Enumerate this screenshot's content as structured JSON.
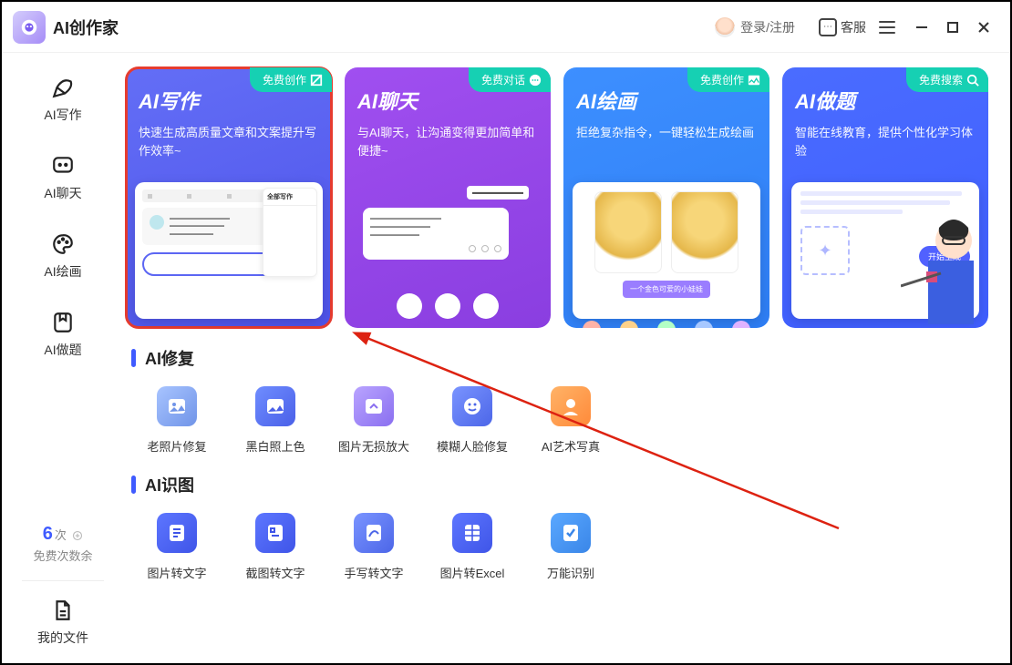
{
  "header": {
    "title": "AI创作家",
    "login": "登录/注册",
    "support": "客服"
  },
  "sidebar": {
    "items": [
      {
        "label": "AI写作"
      },
      {
        "label": "AI聊天"
      },
      {
        "label": "AI绘画"
      },
      {
        "label": "AI做题"
      }
    ],
    "free_count": "6",
    "free_unit": "次",
    "free_label": "免费次数余",
    "files_label": "我的文件"
  },
  "cards": [
    {
      "title": "AI写作",
      "badge": "免费创作",
      "desc": "快速生成高质量文章和文案提升写作效率~",
      "side_header": "全部写作"
    },
    {
      "title": "AI聊天",
      "badge": "免费对话",
      "desc": "与AI聊天，让沟通变得更加简单和便捷~"
    },
    {
      "title": "AI绘画",
      "badge": "免费创作",
      "desc": "拒绝复杂指令，一键轻松生成绘画",
      "tag": "一个金色可爱的小娃娃"
    },
    {
      "title": "AI做题",
      "badge": "免费搜索",
      "desc": "智能在线教育，提供个性化学习体验",
      "btn": "开始生成"
    }
  ],
  "sections": {
    "repair": {
      "title": "AI修复",
      "items": [
        "老照片修复",
        "黑白照上色",
        "图片无损放大",
        "模糊人脸修复",
        "AI艺术写真"
      ]
    },
    "ocr": {
      "title": "AI识图",
      "items": [
        "图片转文字",
        "截图转文字",
        "手写转文字",
        "图片转Excel",
        "万能识别"
      ]
    }
  }
}
